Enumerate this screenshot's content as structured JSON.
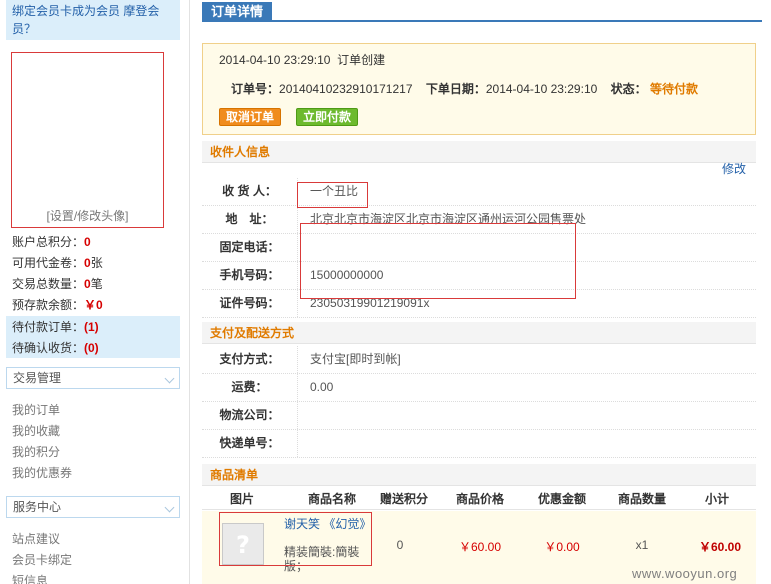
{
  "sidebar": {
    "promo_line1": "绑定会员卡成为会员",
    "promo_link": "摩登会",
    "promo_line2": "员？",
    "avatar_link": "[设置/修改头像]",
    "stats": [
      {
        "label": "账户总积分：",
        "value": "0",
        "suffix": ""
      },
      {
        "label": "可用代金卷：",
        "value": "0",
        "suffix": "张"
      },
      {
        "label": "交易总数量：",
        "value": "0",
        "suffix": "笔"
      },
      {
        "label": "预存款余额：",
        "value": "￥0",
        "suffix": ""
      }
    ],
    "pending": [
      {
        "label": "待付款订单：",
        "value": "(1)"
      },
      {
        "label": "待确认收货：",
        "value": "(0)"
      }
    ],
    "trade_section": "交易管理",
    "trade_links": [
      "我的订单",
      "我的收藏",
      "我的积分",
      "我的优惠券"
    ],
    "service_section": "服务中心",
    "service_links": [
      "站点建议",
      "会员卡绑定",
      "短信息"
    ]
  },
  "order": {
    "tab_label": "订单详情",
    "status_time": "2014-04-10 23:29:10",
    "status_text": "订单创建",
    "order_no_label": "订单号：",
    "order_no": "20140410232910171217",
    "order_date_label": "下单日期：",
    "order_date": "2014-04-10 23:29:10",
    "state_label": "状态：",
    "state": "等待付款",
    "cancel_button": "取消订单",
    "pay_button": "立即付款"
  },
  "recipient": {
    "section_title": "收件人信息",
    "edit_link": "修改",
    "rows": [
      {
        "label": "收 货 人：",
        "value": "一个丑比"
      },
      {
        "label": "地　址：",
        "value": "北京北京市海淀区北京市海淀区通州运河公园售票处"
      },
      {
        "label": "固定电话：",
        "value": ""
      },
      {
        "label": "手机号码：",
        "value": "15000000000"
      },
      {
        "label": "证件号码：",
        "value": "23050319901219091x"
      }
    ]
  },
  "payment": {
    "section_title": "支付及配送方式",
    "rows": [
      {
        "label": "支付方式：",
        "value": "支付宝[即时到帐]"
      },
      {
        "label": "运费：",
        "value": "0.00"
      },
      {
        "label": "物流公司：",
        "value": ""
      },
      {
        "label": "快递单号：",
        "value": ""
      }
    ]
  },
  "products": {
    "section_title": "商品清单",
    "columns": [
      "图片",
      "商品名称",
      "赠送积分",
      "商品价格",
      "优惠金额",
      "商品数量",
      "小计"
    ],
    "items": [
      {
        "name": "谢天笑 《幻觉》",
        "extra": "精装簡裝:簡裝版；",
        "points": "0",
        "price": "￥60.00",
        "discount": "￥0.00",
        "quantity": "x1",
        "subtotal": "￥60.00"
      }
    ]
  },
  "watermark": "www.wooyun.org"
}
